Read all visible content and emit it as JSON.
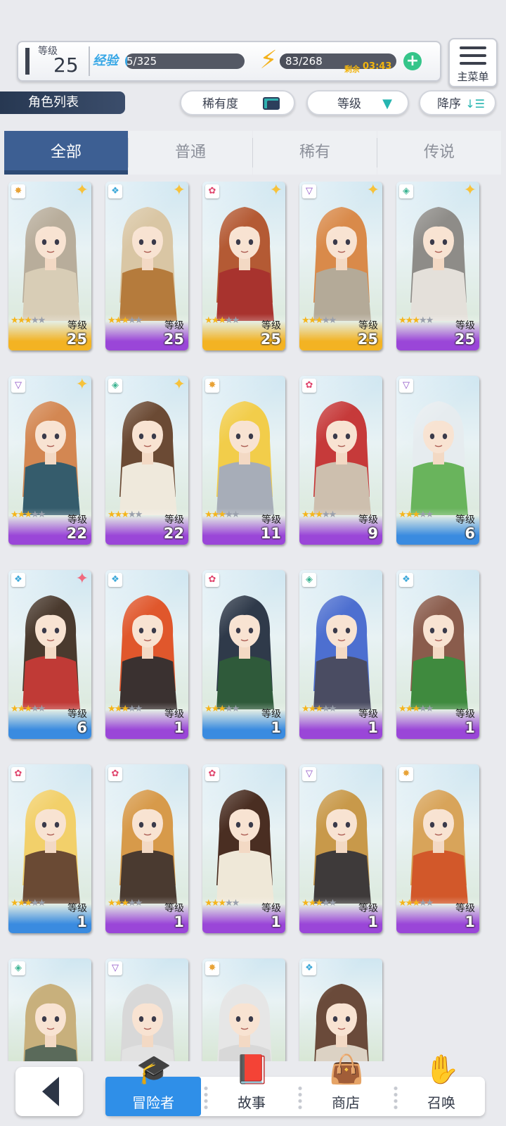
{
  "status": {
    "level_label": "等级",
    "level_value": "25",
    "exp_label": "经验",
    "exp_text": "5/325",
    "exp_fraction": 0.015,
    "energy_text": "83/268",
    "energy_fraction": 0.31,
    "recover_label": "剩余",
    "recover_time": "03:43",
    "add_icon": "plus-icon"
  },
  "main_menu": {
    "label": "主菜单",
    "icon": "hamburger-icon"
  },
  "list_title": "角色列表",
  "sort": {
    "rarity_label": "稀有度",
    "level_label": "等级",
    "order_label": "降序"
  },
  "tabs": [
    {
      "label": "全部",
      "active": true
    },
    {
      "label": "普通",
      "active": false
    },
    {
      "label": "稀有",
      "active": false
    },
    {
      "label": "传说",
      "active": false
    }
  ],
  "level_word": "等级",
  "colors": {
    "elements": {
      "earth": "#e8a236",
      "water": "#3aa7d8",
      "fire": "#e0466e",
      "dark": "#8d52c6",
      "wind": "#3bb391"
    },
    "rarity": {
      "legend": "#f3b323",
      "rare": "#9a46d8",
      "common": "#3a8be0"
    }
  },
  "characters": [
    {
      "element": "earth",
      "rarity": "legend",
      "stars": 3,
      "level": "25",
      "hair": "#b8ad9b",
      "outfit": "#d8cdb6"
    },
    {
      "element": "water",
      "rarity": "rare",
      "stars": 3,
      "level": "25",
      "hair": "#d9c6a4",
      "outfit": "#b57b3c"
    },
    {
      "element": "fire",
      "rarity": "legend",
      "stars": 3,
      "level": "25",
      "hair": "#b45a34",
      "outfit": "#a8332e"
    },
    {
      "element": "dark",
      "rarity": "legend",
      "stars": 3,
      "level": "25",
      "hair": "#d98a4a",
      "outfit": "#b4aa98"
    },
    {
      "element": "wind",
      "rarity": "rare",
      "stars": 3,
      "level": "25",
      "hair": "#8e8c88",
      "outfit": "#e4e0da"
    },
    {
      "element": "dark",
      "rarity": "rare",
      "stars": 3,
      "level": "22",
      "hair": "#d38752",
      "outfit": "#355c6c"
    },
    {
      "element": "wind",
      "rarity": "rare",
      "stars": 3,
      "level": "22",
      "hair": "#6b4a34",
      "outfit": "#efe9dc"
    },
    {
      "element": "earth",
      "rarity": "rare",
      "stars": 3,
      "level": "11",
      "hair": "#f2cd4a",
      "outfit": "#a7adb8"
    },
    {
      "element": "fire",
      "rarity": "rare",
      "stars": 3,
      "level": "9",
      "hair": "#c63a3a",
      "outfit": "#cdbfae"
    },
    {
      "element": "dark",
      "rarity": "common",
      "stars": 3,
      "level": "6",
      "hair": "#e6ecef",
      "outfit": "#69b45c"
    },
    {
      "element": "water",
      "rarity": "common",
      "stars": 3,
      "level": "6",
      "hair": "#4a3a2e",
      "outfit": "#c03a36"
    },
    {
      "element": "water",
      "rarity": "rare",
      "stars": 3,
      "level": "1",
      "hair": "#e0572c",
      "outfit": "#3a3130"
    },
    {
      "element": "fire",
      "rarity": "common",
      "stars": 3,
      "level": "1",
      "hair": "#2f3a4a",
      "outfit": "#2f5a3a"
    },
    {
      "element": "wind",
      "rarity": "rare",
      "stars": 3,
      "level": "1",
      "hair": "#4d6fd0",
      "outfit": "#4a4c62"
    },
    {
      "element": "water",
      "rarity": "rare",
      "stars": 3,
      "level": "1",
      "hair": "#8a5c4c",
      "outfit": "#3f8a3e"
    },
    {
      "element": "fire",
      "rarity": "common",
      "stars": 3,
      "level": "1",
      "hair": "#f2d06a",
      "outfit": "#6a4a34"
    },
    {
      "element": "fire",
      "rarity": "rare",
      "stars": 3,
      "level": "1",
      "hair": "#d79a4a",
      "outfit": "#4a3a30"
    },
    {
      "element": "fire",
      "rarity": "rare",
      "stars": 3,
      "level": "1",
      "hair": "#4a2e22",
      "outfit": "#efe8d8"
    },
    {
      "element": "dark",
      "rarity": "rare",
      "stars": 3,
      "level": "1",
      "hair": "#c8994a",
      "outfit": "#3e3a3a"
    },
    {
      "element": "earth",
      "rarity": "rare",
      "stars": 3,
      "level": "1",
      "hair": "#d8a45a",
      "outfit": "#d2582a"
    },
    {
      "element": "wind",
      "rarity": "rare",
      "stars": 0,
      "level": "",
      "hair": "#c8b07c",
      "outfit": "#5a6a5a"
    },
    {
      "element": "dark",
      "rarity": "rare",
      "stars": 0,
      "level": "",
      "hair": "#d8d8d8",
      "outfit": "#e2e2e2"
    },
    {
      "element": "earth",
      "rarity": "rare",
      "stars": 0,
      "level": "",
      "hair": "#e6e6e6",
      "outfit": "#d8d8d8"
    },
    {
      "element": "water",
      "rarity": "rare",
      "stars": 0,
      "level": "",
      "hair": "#6a4a3a",
      "outfit": "#dcd2c4"
    }
  ],
  "nav": [
    {
      "label": "冒险者",
      "icon": "adventurer-icon",
      "active": true
    },
    {
      "label": "故事",
      "icon": "book-icon",
      "active": false
    },
    {
      "label": "商店",
      "icon": "shop-bag-icon",
      "active": false
    },
    {
      "label": "召唤",
      "icon": "summon-hand-icon",
      "active": false
    }
  ],
  "back_icon": "back-arrow-icon"
}
